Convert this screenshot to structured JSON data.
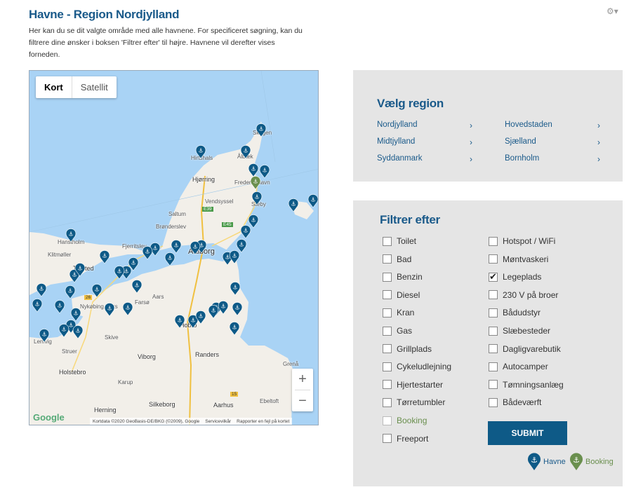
{
  "header": {
    "title": "Havne - Region Nordjylland",
    "intro": "Her kan du se dit valgte område med alle havnene. For specificeret søgning, kan du filtrere dine ønsker i boksen 'Filtrer efter' til højre. Havnene vil derefter vises forneden."
  },
  "map": {
    "map_type_options": [
      "Kort",
      "Satellit"
    ],
    "selected_map_type": "Kort",
    "zoom_in": "+",
    "zoom_out": "−",
    "logo": "Google",
    "attribution": [
      "Kortdata ©2020 GeoBasis-DE/BKG (©2009), Google",
      "Servicevilkår",
      "Rapporter en fejl på kortet"
    ],
    "place_labels": [
      "Skagen",
      "Hirtshals",
      "Ålbæk",
      "Hjørring",
      "Frederikshavn",
      "Vendsyssel",
      "Sæby",
      "Saltum",
      "Hanstholm",
      "Brønderslev",
      "Fjerritslev",
      "Aalborg",
      "Klitmøller",
      "Thisted",
      "Nykøbing Mors",
      "Farsø",
      "Aars",
      "Hobro",
      "Skive",
      "Struer",
      "Lemvig",
      "Holstebro",
      "Viborg",
      "Randers",
      "Grenå",
      "Karup",
      "Herning",
      "Silkeborg",
      "Aarhus",
      "Ebeltoft"
    ],
    "road_labels": [
      "E39",
      "E45",
      "26",
      "15"
    ]
  },
  "region": {
    "title": "Vælg region",
    "items": [
      "Nordjylland",
      "Hovedstaden",
      "Midtjylland",
      "Sjælland",
      "Syddanmark",
      "Bornholm"
    ]
  },
  "filter": {
    "title": "Filtrer efter",
    "left": [
      {
        "label": "Toilet",
        "checked": false
      },
      {
        "label": "Bad",
        "checked": false
      },
      {
        "label": "Benzin",
        "checked": false
      },
      {
        "label": "Diesel",
        "checked": false
      },
      {
        "label": "Kran",
        "checked": false
      },
      {
        "label": "Gas",
        "checked": false
      },
      {
        "label": "Grillplads",
        "checked": false
      },
      {
        "label": "Cykeludlejning",
        "checked": false
      },
      {
        "label": "Hjertestarter",
        "checked": false
      },
      {
        "label": "Tørretumbler",
        "checked": false
      },
      {
        "label": "Booking",
        "checked": false
      },
      {
        "label": "Freeport",
        "checked": false
      }
    ],
    "right": [
      {
        "label": "Hotspot / WiFi",
        "checked": false
      },
      {
        "label": "Møntvaskeri",
        "checked": false
      },
      {
        "label": "Legeplads",
        "checked": true
      },
      {
        "label": "230 V på broer",
        "checked": false
      },
      {
        "label": "Bådudstyr",
        "checked": false
      },
      {
        "label": "Slæbesteder",
        "checked": false
      },
      {
        "label": "Dagligvarebutik",
        "checked": false
      },
      {
        "label": "Autocamper",
        "checked": false
      },
      {
        "label": "Tømningsanlæg",
        "checked": false
      },
      {
        "label": "Bådeværft",
        "checked": false
      }
    ],
    "submit": "SUBMIT",
    "legend": {
      "havne": "Havne",
      "booking": "Booking"
    }
  },
  "colors": {
    "accent": "#1a5a8a",
    "pin": "#0e5a87",
    "booking": "#6a8f4e",
    "panel": "#e5e5e5",
    "water": "#a9d3f5",
    "land": "#f2efe9"
  },
  "icons": [
    "gear-icon",
    "chevron-right-icon",
    "anchor-icon",
    "checkmark-icon"
  ]
}
